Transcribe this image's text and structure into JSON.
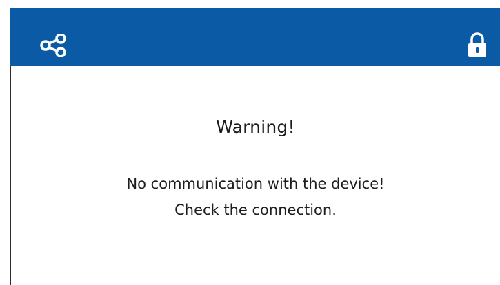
{
  "header": {
    "background_color": "#0a5aa6",
    "left_icon": "share-icon",
    "right_icon": "lock-icon"
  },
  "dialog": {
    "title": "Warning!",
    "message_line1": "No communication with the device!",
    "message_line2": "Check the connection."
  }
}
